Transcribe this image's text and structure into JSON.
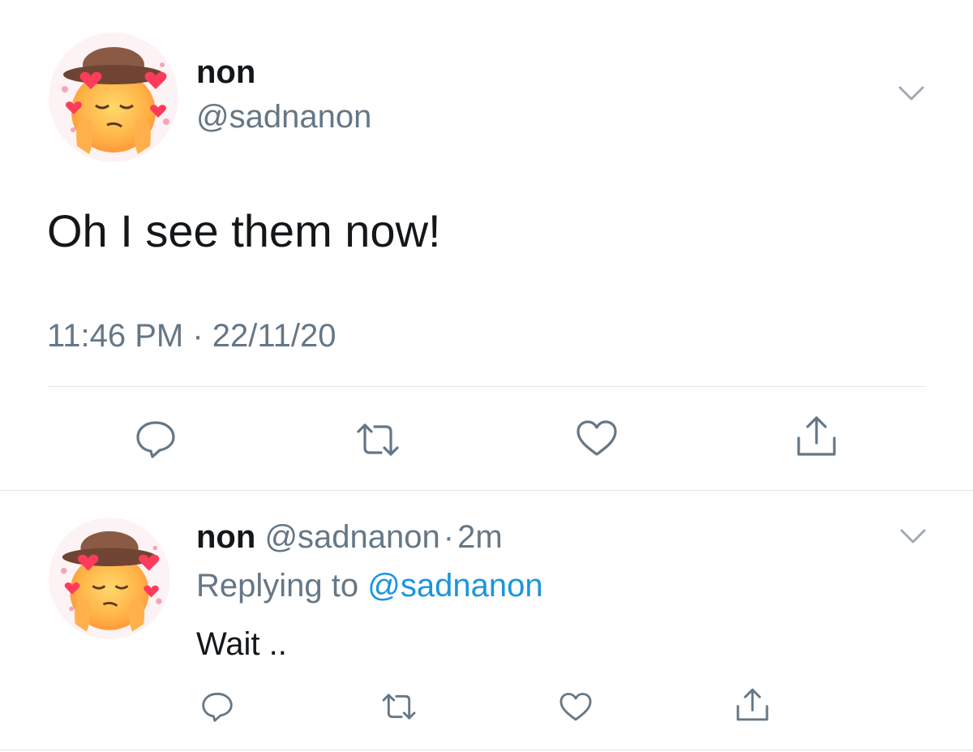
{
  "colors": {
    "text": "#14171a",
    "muted": "#657786",
    "accent": "#1b95e0",
    "divider": "#e1e8ed"
  },
  "main_tweet": {
    "display_name": "non",
    "handle": "@sadnanon",
    "text": "Oh I see them now!",
    "timestamp": "11:46 PM · 22/11/20",
    "avatar_icon": "pleading-face-cowboy-hearts-emoji",
    "menu_icon": "chevron-down-icon",
    "actions": [
      "reply-icon",
      "retweet-icon",
      "like-icon",
      "share-icon"
    ]
  },
  "reply_tweet": {
    "display_name": "non",
    "handle": "@sadnanon",
    "separator": "·",
    "time_ago": "2m",
    "replying_prefix": "Replying to",
    "replying_handle": "@sadnanon",
    "text": "Wait ..",
    "avatar_icon": "pleading-face-cowboy-hearts-emoji",
    "menu_icon": "chevron-down-icon",
    "actions": [
      "reply-icon",
      "retweet-icon",
      "like-icon",
      "share-icon"
    ]
  }
}
